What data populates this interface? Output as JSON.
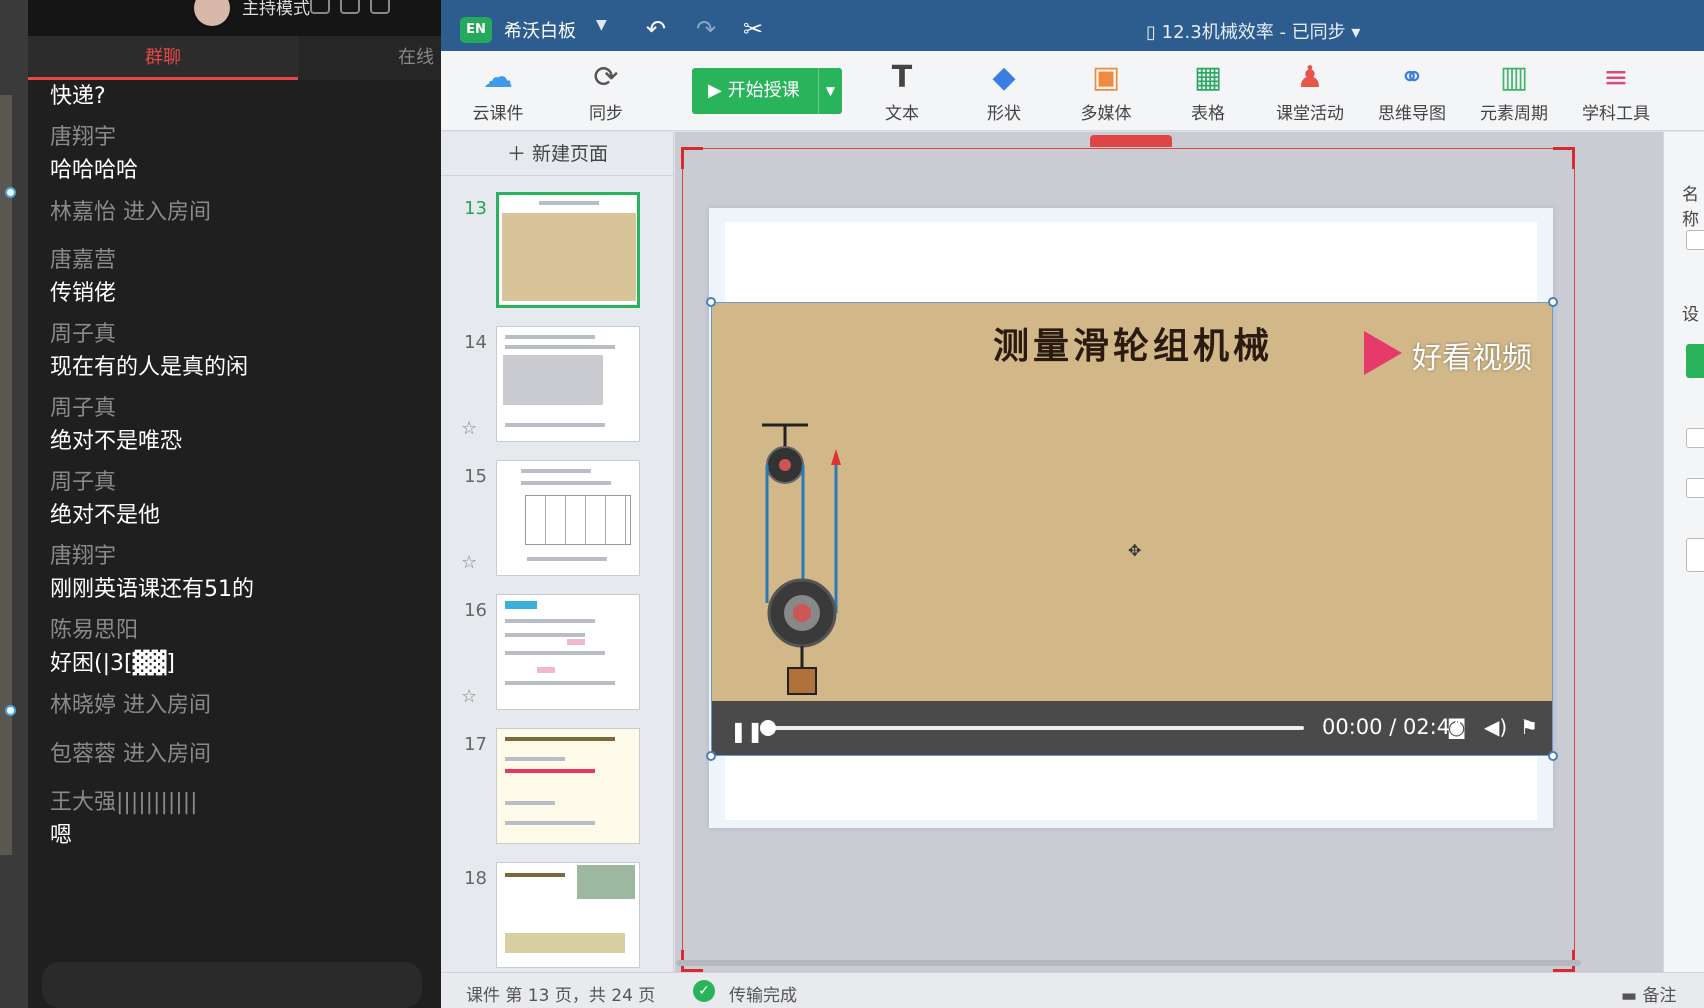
{
  "chat": {
    "top_mode": "主持模式",
    "tabs": {
      "group": "群聊",
      "online": "在线"
    },
    "messages": [
      {
        "name": "唐翔宇",
        "text": "快递?"
      },
      {
        "name": "唐翔宇",
        "text": "哈哈哈哈"
      },
      {
        "system": "林嘉怡 进入房间"
      },
      {
        "name": "唐嘉营",
        "text": "传销佬"
      },
      {
        "name": "周子真",
        "text": "现在有的人是真的闲"
      },
      {
        "name": "周子真",
        "text": "绝对不是唯恐"
      },
      {
        "name": "周子真",
        "text": "绝对不是他"
      },
      {
        "name": "唐翔宇",
        "text": "刚刚英语课还有51的"
      },
      {
        "name": "陈易思阳",
        "text": "好困(|3[▓▓]"
      },
      {
        "system": "林晓婷 进入房间"
      },
      {
        "system": "包蓉蓉 进入房间"
      },
      {
        "name": "王大强|||||||||||",
        "text": "嗯"
      }
    ]
  },
  "app": {
    "logo": "EN",
    "name": "希沃白板",
    "doc_title": "12.3机械效率 - 已同步",
    "toolbar": {
      "cloud": "云课件",
      "sync": "同步",
      "start": "开始授课",
      "text": "文本",
      "shape": "形状",
      "media": "多媒体",
      "table": "表格",
      "activity": "课堂活动",
      "mindmap": "思维导图",
      "periodic": "元素周期",
      "subject": "学科工具"
    },
    "new_page": "新建页面",
    "thumbnails": [
      {
        "num": "13",
        "active": true
      },
      {
        "num": "14",
        "active": false
      },
      {
        "num": "15",
        "active": false
      },
      {
        "num": "16",
        "active": false
      },
      {
        "num": "17",
        "active": false
      },
      {
        "num": "18",
        "active": false
      }
    ],
    "video": {
      "title": "测量滑轮组机械",
      "brand": "好看视频",
      "time": "00:00 / 02:44",
      "progress": 0
    },
    "right_panel": {
      "name_label": "名称",
      "settings_label": "设"
    },
    "status": {
      "page_info": "课件 第 13 页，共 24 页",
      "transfer": "传输完成",
      "note": "备注"
    }
  }
}
